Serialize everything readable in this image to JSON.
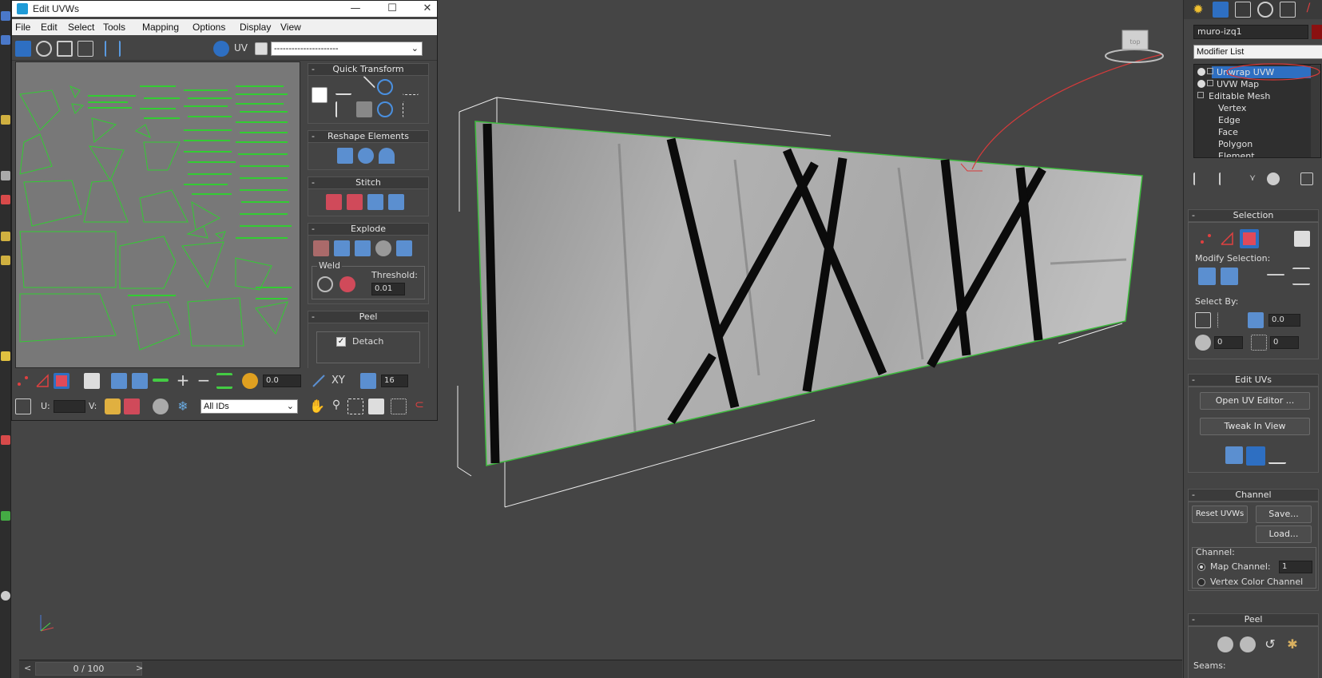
{
  "uvw_window": {
    "title": "Edit UVWs",
    "menu": [
      "File",
      "Edit",
      "Select",
      "Tools",
      "Mapping",
      "Options",
      "Display",
      "View"
    ],
    "uv_label": "UV",
    "map_dropdown": "----------------------",
    "rollouts": {
      "quick_transform": "Quick Transform",
      "reshape": "Reshape Elements",
      "stitch": "Stitch",
      "explode": "Explode",
      "weld": "Weld",
      "threshold_label": "Threshold:",
      "threshold_value": "0.01",
      "peel": "Peel",
      "detach": "Detach"
    },
    "bottom": {
      "soft_value": "0.0",
      "xy_label": "XY",
      "grid_value": "16",
      "u_label": "U:",
      "v_label": "V:",
      "ids_dropdown": "All IDs"
    }
  },
  "timeline": {
    "frame": "0 / 100"
  },
  "command_panel": {
    "object_name": "muro-izq1",
    "modifier_list": "Modifier List",
    "stack": [
      {
        "label": "Unwrap UVW",
        "selected": true
      },
      {
        "label": "UVW Map",
        "selected": false
      },
      {
        "label": "Editable Mesh",
        "selected": false
      },
      {
        "label": "Vertex",
        "selected": false
      },
      {
        "label": "Edge",
        "selected": false
      },
      {
        "label": "Face",
        "selected": false
      },
      {
        "label": "Polygon",
        "selected": false
      },
      {
        "label": "Element",
        "selected": false
      }
    ],
    "selection": {
      "title": "Selection",
      "modify_selection": "Modify Selection:",
      "select_by": "Select By:",
      "angle_value": "0.0",
      "spin_a": "0",
      "spin_b": "0"
    },
    "edit_uvs": {
      "title": "Edit UVs",
      "open_editor": "Open UV Editor ...",
      "tweak": "Tweak In View"
    },
    "channel": {
      "title": "Channel",
      "reset": "Reset UVWs",
      "save": "Save...",
      "load": "Load...",
      "channel_label": "Channel:",
      "map_channel": "Map Channel:",
      "map_channel_value": "1",
      "vertex_color": "Vertex Color Channel"
    },
    "peel": {
      "title": "Peel",
      "seams": "Seams:"
    }
  },
  "colors": {
    "accent": "#2e6fc2",
    "uv_wire": "#33cc33",
    "selection_red": "#e04040"
  }
}
